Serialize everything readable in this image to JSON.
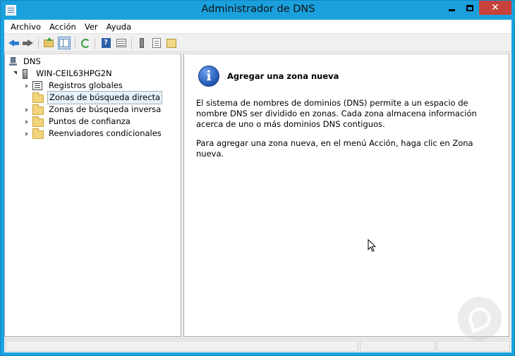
{
  "window": {
    "title": "Administrador de DNS",
    "close_glyph": "✕"
  },
  "menu": [
    "Archivo",
    "Acción",
    "Ver",
    "Ayuda"
  ],
  "toolbar": {
    "icons": [
      "back-arrow-icon",
      "forward-arrow-icon",
      "up-folder-icon",
      "show-hide-tree-icon",
      "refresh-icon",
      "help-icon",
      "properties-icon",
      "server-icon",
      "list-icon",
      "records-icon"
    ],
    "help_glyph": "?"
  },
  "tree": {
    "root": "DNS",
    "server": "WIN-CEIL63HPG2N",
    "items": [
      {
        "label": "Registros globales"
      },
      {
        "label": "Zonas de búsqueda directa"
      },
      {
        "label": "Zonas de búsqueda inversa"
      },
      {
        "label": "Puntos de confianza"
      },
      {
        "label": "Reenviadores condicionales"
      }
    ]
  },
  "detail": {
    "info_glyph": "i",
    "title": "Agregar una zona nueva",
    "paragraph1": "El sistema de nombres de dominios (DNS) permite a un espacio de nombre DNS ser dividido en zonas. Cada zona almacena información acerca de uno o más dominios DNS contiguos.",
    "paragraph2": "Para agregar una zona nueva, en el menú Acción, haga clic en Zona nueva."
  },
  "colors": {
    "titlebar": "#1aa0dc",
    "close_button": "#c7423a",
    "selection": "#e5f1fb"
  }
}
